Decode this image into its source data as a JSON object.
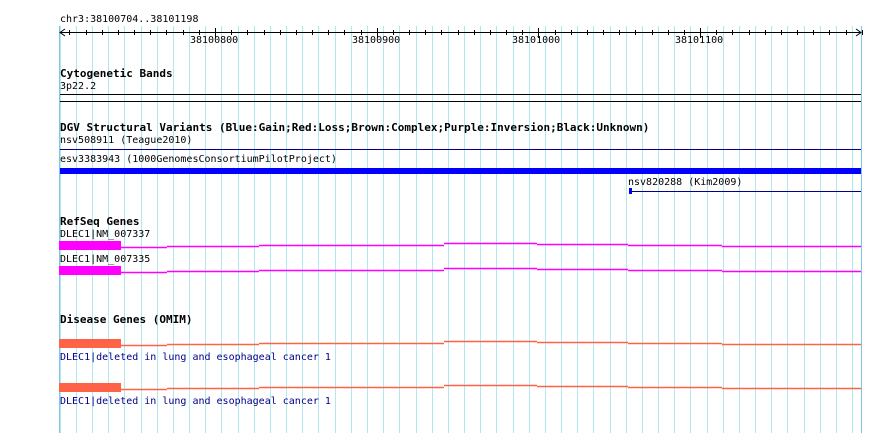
{
  "ruler": {
    "location": "chr3:38100704..38101198",
    "ticks": [
      "38100800",
      "38100900",
      "38101000",
      "38101100"
    ]
  },
  "tracks": {
    "cytoband": {
      "title": "Cytogenetic Bands",
      "band": "3p22.2"
    },
    "dgv": {
      "title": "DGV Structural Variants (Blue:Gain;Red:Loss;Brown:Complex;Purple:Inversion;Black:Unknown)",
      "features": [
        "nsv508911 (Teague2010)",
        "esv3383943 (1000GenomesConsortiumPilotProject)",
        "nsv820288 (Kim2009)"
      ]
    },
    "refseq": {
      "title": "RefSeq Genes",
      "features": [
        "DLEC1|NM_007337",
        "DLEC1|NM_007335"
      ]
    },
    "omim": {
      "title": "Disease Genes (OMIM)",
      "features": [
        "DLEC1|deleted in lung and esophageal cancer 1",
        "DLEC1|deleted in lung and esophageal cancer 1"
      ]
    }
  },
  "colors": {
    "grid_minor": "#b0e8ef",
    "grid_major": "#7fc4ea",
    "gain": "#0000ff",
    "refseq": "#ff00ff",
    "omim": "#ff6347",
    "link": "#00008b"
  }
}
